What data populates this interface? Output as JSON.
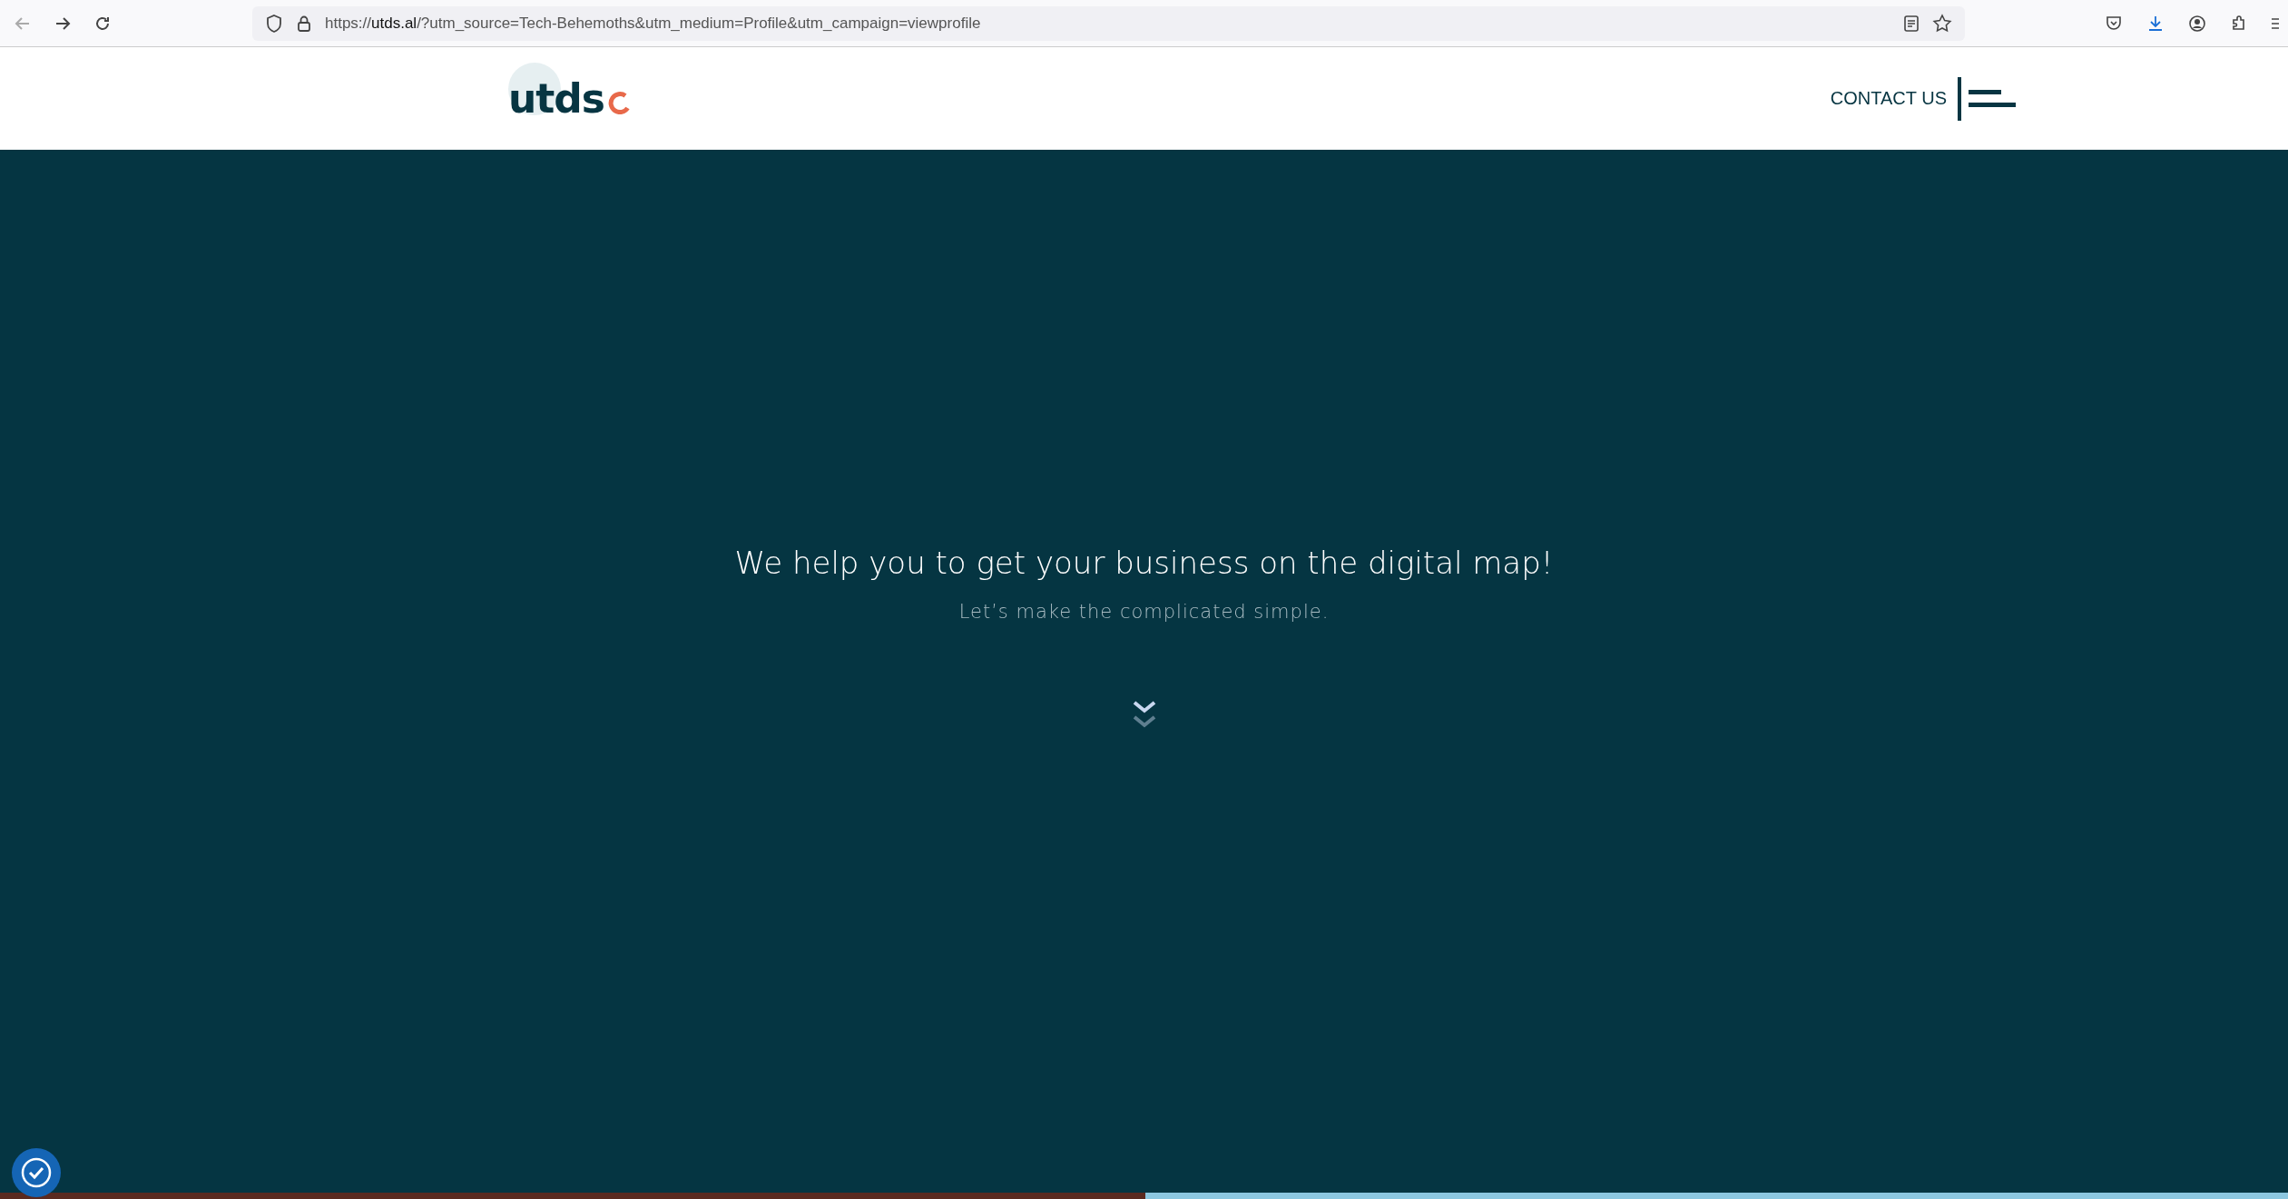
{
  "browser": {
    "url": "https://**utds.al**/?utm_source=Tech-Behemoths&utm_medium=Profile&utm_campaign=viewprofile"
  },
  "header": {
    "logo": "utds",
    "contact": "CONTACT US"
  },
  "hero": {
    "title": "We help you to get your business on the digital map!",
    "subtitle": "Let’s make the complicated simple."
  }
}
